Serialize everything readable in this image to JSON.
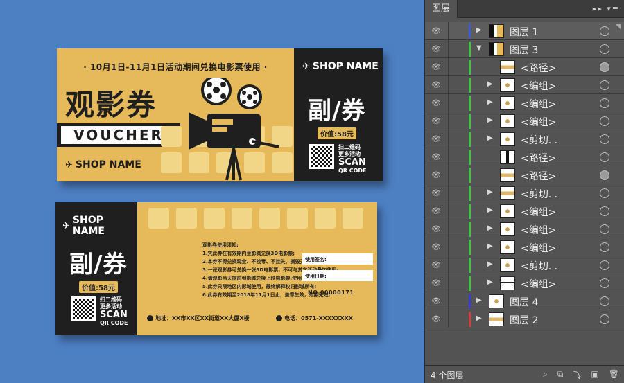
{
  "front_ticket": {
    "promo": "· 10月1日-11月1日活动期间兑换电影票使用 ·",
    "title": "观影券",
    "voucher": "VOUCHER",
    "shop_name": "SHOP NAME",
    "stub_title": "副/券",
    "price": "价值:58元",
    "scan_cn_1": "扫二维码",
    "scan_cn_2": "更多活动",
    "scan": "SCAN",
    "qr_code": "QR CODE"
  },
  "back_ticket": {
    "shop_name": "SHOP NAME",
    "stub_title": "副/券",
    "price": "价值:58元",
    "scan_cn_1": "扫二维码",
    "scan_cn_2": "更多活动",
    "scan": "SCAN",
    "qr_code": "QR CODE",
    "rules": [
      "观影券使用须知:",
      "1.凭此券在有效期内至影城兑换3D电影票;",
      "2.本券不得兑换现金、不找零、不挂失、撕毁无效;",
      "3.一张观影券可兑换一张3D电影票，不可与其它活动叠加使用;",
      "4.请观影当天提前到影城兑换上映电影票,使用后由影城回收;",
      "5.此券只限地区内影城使用，最终解释权归影城所有;",
      "6.此券有效期至2018年11月1日止，盖章生效，过期无效;"
    ],
    "sign_label": "使用签名:",
    "date_label": "使用日期:",
    "serial": "NO.00000171",
    "address": "地址：XX市XX区XX街道XX大厦X楼",
    "phone": "电话：0571-XXXXXXXX"
  },
  "layers_panel": {
    "tab": "图层",
    "menu_icons": "▸▸ ▾≡",
    "rows": [
      {
        "label": "图层 1",
        "color": "#3c5bd6",
        "arrow": "▶",
        "thumb": "mix",
        "indent": 0,
        "target": "empty"
      },
      {
        "label": "图层 3",
        "color": "#3fc43f",
        "arrow": "▼",
        "thumb": "mix",
        "indent": 0,
        "target": "empty"
      },
      {
        "label": "<路径>",
        "color": "#3fc43f",
        "arrow": "",
        "thumb": "gold-thumb",
        "indent": 1,
        "target": "filled"
      },
      {
        "label": "<编组>",
        "color": "#3fc43f",
        "arrow": "▶",
        "thumb": "star",
        "indent": 1,
        "target": "empty"
      },
      {
        "label": "<编组>",
        "color": "#3fc43f",
        "arrow": "▶",
        "thumb": "star",
        "indent": 1,
        "target": "empty"
      },
      {
        "label": "<编组>",
        "color": "#3fc43f",
        "arrow": "▶",
        "thumb": "star",
        "indent": 1,
        "target": "empty"
      },
      {
        "label": "<剪切. .",
        "color": "#3fc43f",
        "arrow": "▶",
        "thumb": "star",
        "indent": 1,
        "target": "empty"
      },
      {
        "label": "<路径>",
        "color": "#3fc43f",
        "arrow": "",
        "thumb": "bar",
        "indent": 1,
        "target": "empty"
      },
      {
        "label": "<路径>",
        "color": "#3fc43f",
        "arrow": "",
        "thumb": "gold-thumb",
        "indent": 1,
        "target": "filled"
      },
      {
        "label": "<剪切. .",
        "color": "#3fc43f",
        "arrow": "▶",
        "thumb": "gold-thumb",
        "indent": 1,
        "target": "empty"
      },
      {
        "label": "<编组>",
        "color": "#3fc43f",
        "arrow": "▶",
        "thumb": "star",
        "indent": 1,
        "target": "empty"
      },
      {
        "label": "<编组>",
        "color": "#3fc43f",
        "arrow": "▶",
        "thumb": "star",
        "indent": 1,
        "target": "empty"
      },
      {
        "label": "<编组>",
        "color": "#3fc43f",
        "arrow": "▶",
        "thumb": "star",
        "indent": 1,
        "target": "empty"
      },
      {
        "label": "<剪切. .",
        "color": "#3fc43f",
        "arrow": "▶",
        "thumb": "star",
        "indent": 1,
        "target": "empty"
      },
      {
        "label": "<编组>",
        "color": "#3fc43f",
        "arrow": "▶",
        "thumb": "lines",
        "indent": 1,
        "target": "empty"
      },
      {
        "label": "图层 4",
        "color": "#3c3cd6",
        "arrow": "▶",
        "thumb": "star",
        "indent": 0,
        "target": "empty"
      },
      {
        "label": "图层 2",
        "color": "#d63c3c",
        "arrow": "▶",
        "thumb": "gold-thumb",
        "indent": 0,
        "target": "empty"
      }
    ],
    "footer_count": "4 个图层"
  }
}
